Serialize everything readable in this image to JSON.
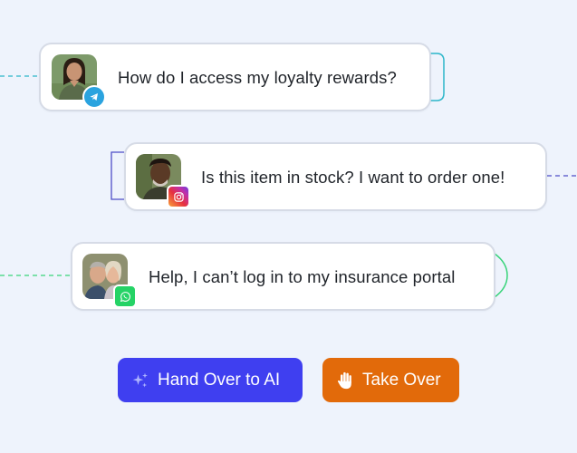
{
  "messages": [
    {
      "text": "How do I access my loyalty rewards?",
      "channel": "telegram-icon"
    },
    {
      "text": "Is this item in stock? I want to order one!",
      "channel": "instagram-icon"
    },
    {
      "text": "Help, I can’t log in to my insurance portal",
      "channel": "whatsapp-icon"
    }
  ],
  "actions": {
    "hand_over_label": "Hand Over to AI",
    "take_over_label": "Take Over"
  },
  "colors": {
    "background": "#eef3fc",
    "hand_over_bg": "#3f3ff0",
    "take_over_bg": "#e26a0a",
    "telegram": "#2aa3df",
    "whatsapp": "#25d366",
    "connector_teal": "#2bb6c9",
    "connector_indigo": "#4d4dc7",
    "connector_green": "#38d47a"
  }
}
